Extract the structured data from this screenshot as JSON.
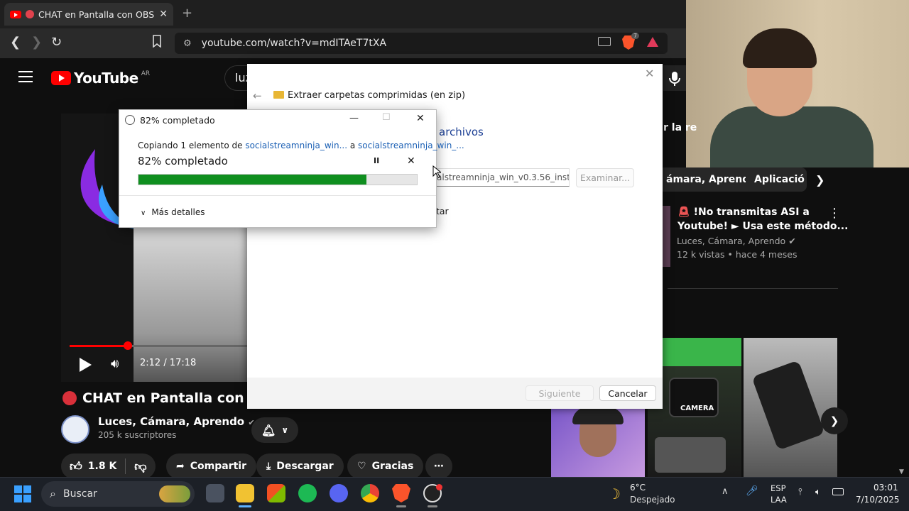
{
  "browser": {
    "tab_title": "CHAT en Pantalla con OBS Stu",
    "tab_close": "✕",
    "new_tab": "+",
    "url": "youtube.com/watch?v=mdITAeT7tXA",
    "brave_badge": "7"
  },
  "youtube": {
    "logo_text": "YouTube",
    "country": "AR",
    "search_partial": "luz",
    "video_time": "2:12 / 17:18",
    "progress_fraction": 0.124,
    "video_title": "CHAT en Pantalla con OBS",
    "channel_name": "Luces, Cámara, Aprendo",
    "subscribers": "205 k suscriptores",
    "likes": "1.8 K",
    "share_label": "Compartir",
    "download_label": "Descargar",
    "thanks_label": "Gracias",
    "more_label": "⋯",
    "chip_partial_top": "r la re",
    "chips": [
      "ámara, Aprendo",
      "Aplicació"
    ],
    "side_video_title_1": "!No transmitas ASI a",
    "side_video_title_2": "Youtube! ► Usa este método...",
    "side_video_channel": "Luces, Cámara, Aprendo",
    "side_video_meta": "12 k vistas • hace 4 meses",
    "thumb_label": "CAMERA"
  },
  "zip_dialog": {
    "header": "Extraer carpetas comprimidas (en zip)",
    "partial_heading": "archivos",
    "path_partial": "alstreamninja_win_v0.3.56_installer",
    "browse_label": "Examinar...",
    "checkbox_partial": "tar",
    "next_label": "Siguiente",
    "cancel_label": "Cancelar"
  },
  "copy_dialog": {
    "window_title": "82% completado",
    "copy_line_prefix": "Copiando 1 elemento de",
    "source": "socialstreamninja_win...",
    "connector": "a",
    "destination": "socialstreamninja_win_...",
    "percent_text": "82% completado",
    "progress_fraction": 0.82,
    "details_label": "Más detalles",
    "pause_symbol": "II",
    "cancel_symbol": "✕",
    "minimize": "—",
    "maximize": "☐",
    "close": "✕"
  },
  "taskbar": {
    "search_label": "Buscar",
    "temperature": "6°C",
    "weather": "Despejado",
    "lang_1": "ESP",
    "lang_2": "LAA",
    "time": "03:01",
    "date": "7/10/2025"
  },
  "colors": {
    "youtube_red": "#ff0000",
    "progress_green": "#0f8f1f",
    "link_blue": "#1a5fb4"
  }
}
